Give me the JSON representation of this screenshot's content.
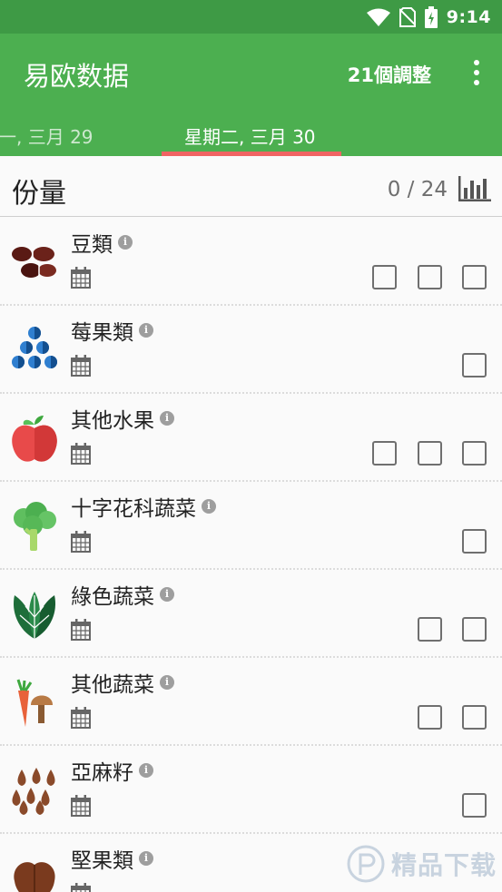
{
  "status": {
    "time": "9:14",
    "icons": [
      "wifi-icon",
      "no-sim-icon",
      "battery-charging-icon"
    ]
  },
  "appbar": {
    "title": "易欧数据",
    "adjust_label": "21個調整",
    "menu_icon": "more-vert-icon"
  },
  "tabs": {
    "prev": "一, 三月 29",
    "active": "星期二, 三月 30",
    "indicator_color": "#f06363"
  },
  "servings": {
    "title": "份量",
    "count": "0 / 24",
    "stats_icon": "bar-chart-icon"
  },
  "foods": [
    {
      "name": "豆類",
      "icon": "beans-icon",
      "checkboxes": 3
    },
    {
      "name": "莓果類",
      "icon": "berries-icon",
      "checkboxes": 1
    },
    {
      "name": "其他水果",
      "icon": "apple-icon",
      "checkboxes": 3
    },
    {
      "name": "十字花科蔬菜",
      "icon": "broccoli-icon",
      "checkboxes": 1
    },
    {
      "name": "綠色蔬菜",
      "icon": "leafy-greens-icon",
      "checkboxes": 2
    },
    {
      "name": "其他蔬菜",
      "icon": "carrot-mushroom-icon",
      "checkboxes": 2
    },
    {
      "name": "亞麻籽",
      "icon": "flaxseed-icon",
      "checkboxes": 1
    },
    {
      "name": "堅果類",
      "icon": "nuts-icon",
      "checkboxes": 0
    }
  ],
  "colors": {
    "primary": "#4caf50",
    "status_bar": "#3e9a45",
    "accent": "#f06363"
  },
  "watermark": {
    "text": "精品下载"
  }
}
